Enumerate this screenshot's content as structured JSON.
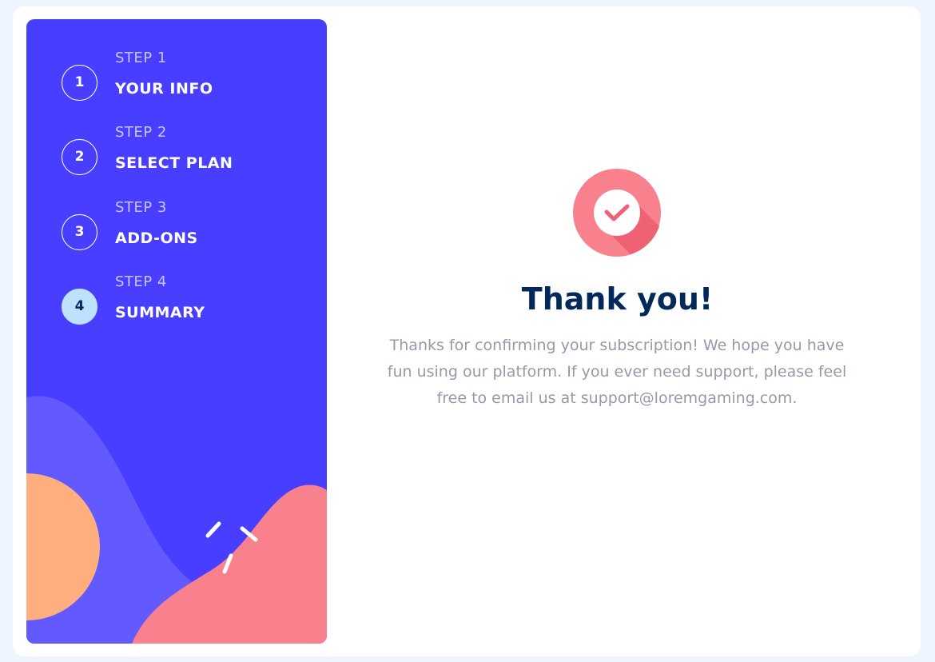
{
  "steps": [
    {
      "number": "1",
      "label": "STEP 1",
      "title": "YOUR INFO",
      "active": false
    },
    {
      "number": "2",
      "label": "STEP 2",
      "title": "SELECT PLAN",
      "active": false
    },
    {
      "number": "3",
      "label": "STEP 3",
      "title": "ADD-ONS",
      "active": false
    },
    {
      "number": "4",
      "label": "STEP 4",
      "title": "SUMMARY",
      "active": true
    }
  ],
  "confirmation": {
    "icon": "checkmark-icon",
    "title": "Thank you!",
    "message": "Thanks for confirming your subscription! We hope you have fun using our platform. If you ever need support, please feel free to email us at support@loremgaming.com."
  },
  "colors": {
    "sidebar_bg": "#483eff",
    "active_step_bg": "#bee2fd",
    "title_color": "#02295a",
    "text_color": "#9699ab",
    "icon_color": "#f9818e"
  }
}
